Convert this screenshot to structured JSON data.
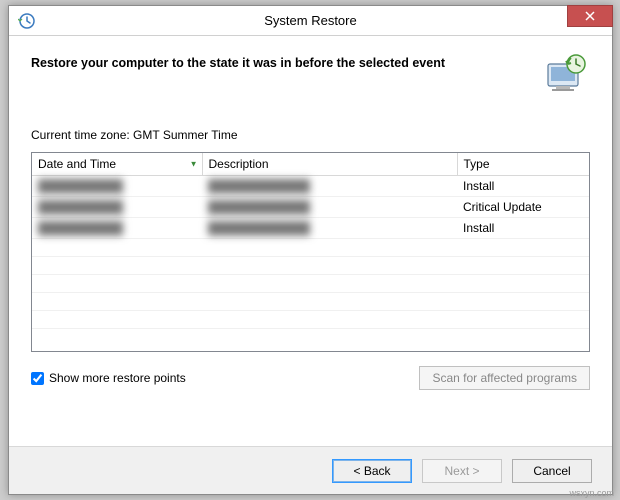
{
  "titlebar": {
    "title": "System Restore"
  },
  "header": {
    "heading": "Restore your computer to the state it was in before the selected event"
  },
  "timezone_label": "Current time zone: GMT Summer Time",
  "columns": {
    "date": "Date and Time",
    "description": "Description",
    "type": "Type"
  },
  "rows": [
    {
      "date": "██████████",
      "description": "████████████",
      "type": "Install"
    },
    {
      "date": "██████████",
      "description": "████████████",
      "type": "Critical Update"
    },
    {
      "date": "██████████",
      "description": "████████████",
      "type": "Install"
    }
  ],
  "checkbox": {
    "label": "Show more restore points",
    "checked": true
  },
  "buttons": {
    "scan": "Scan for affected programs",
    "back": "< Back",
    "next": "Next >",
    "cancel": "Cancel"
  },
  "watermark": "wsxyn.com"
}
